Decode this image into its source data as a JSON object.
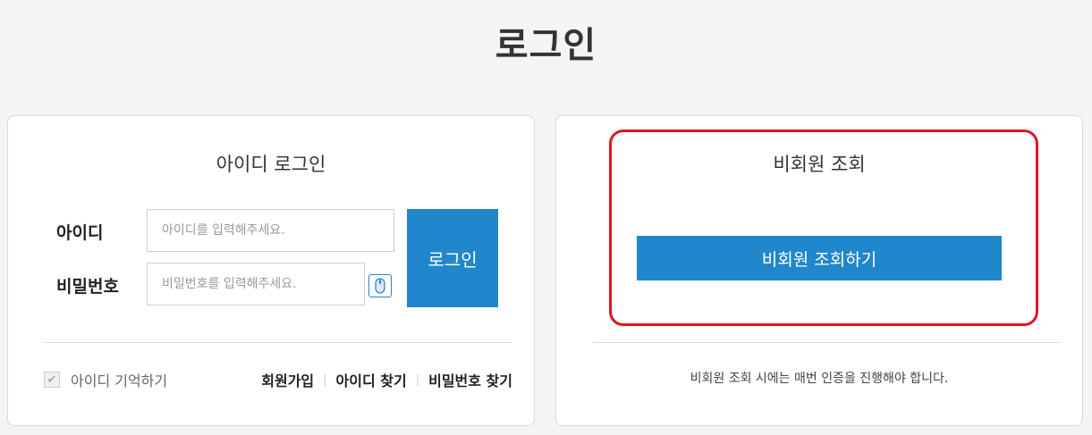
{
  "page": {
    "title": "로그인"
  },
  "id_login": {
    "heading": "아이디 로그인",
    "id_label": "아이디",
    "id_placeholder": "아이디를 입력해주세요.",
    "pw_label": "비밀번호",
    "pw_placeholder": "비밀번호를 입력해주세요.",
    "keypad_icon": "mouse-icon",
    "login_button": "로그인",
    "remember_label": "아이디 기억하기",
    "links": [
      "회원가입",
      "아이디 찾기",
      "비밀번호 찾기"
    ]
  },
  "guest": {
    "heading": "비회원 조회",
    "button": "비회원 조회하기",
    "notice": "비회원 조회 시에는 매번 인증을 진행해야 합니다."
  },
  "colors": {
    "accent": "#2187cc",
    "highlight": "#e2141e",
    "background": "#f4f4f4"
  }
}
